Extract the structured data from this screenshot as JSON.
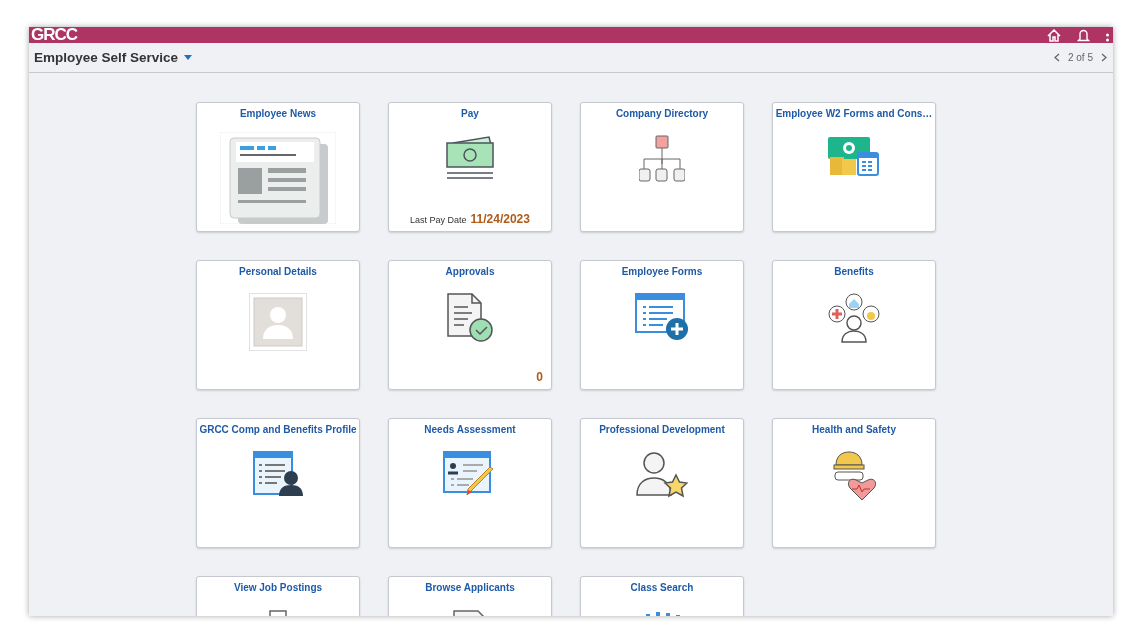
{
  "header": {
    "logo": "GRCC"
  },
  "page": {
    "title": "Employee Self Service",
    "pager": "2 of 5"
  },
  "tiles": [
    {
      "title": "Employee News",
      "kind": "newspaper"
    },
    {
      "title": "Pay",
      "kind": "money",
      "footer_label": "Last Pay Date",
      "footer_value": "11/24/2023"
    },
    {
      "title": "Company Directory",
      "kind": "org-chart"
    },
    {
      "title": "Employee W2 Forms and Cons…",
      "kind": "money-calendar"
    },
    {
      "title": "Personal Details",
      "kind": "photo"
    },
    {
      "title": "Approvals",
      "kind": "doc-check",
      "count": "0"
    },
    {
      "title": "Employee Forms",
      "kind": "form-plus"
    },
    {
      "title": "Benefits",
      "kind": "benefits"
    },
    {
      "title": "GRCC Comp and Benefits Profile",
      "kind": "profile-form"
    },
    {
      "title": "Needs Assessment",
      "kind": "form-pencil"
    },
    {
      "title": "Professional Development",
      "kind": "person-star"
    },
    {
      "title": "Health and Safety",
      "kind": "hardhat-heart"
    },
    {
      "title": "View Job Postings",
      "kind": "briefcase"
    },
    {
      "title": "Browse Applicants",
      "kind": "document"
    },
    {
      "title": "Class Search",
      "kind": "bars"
    }
  ]
}
